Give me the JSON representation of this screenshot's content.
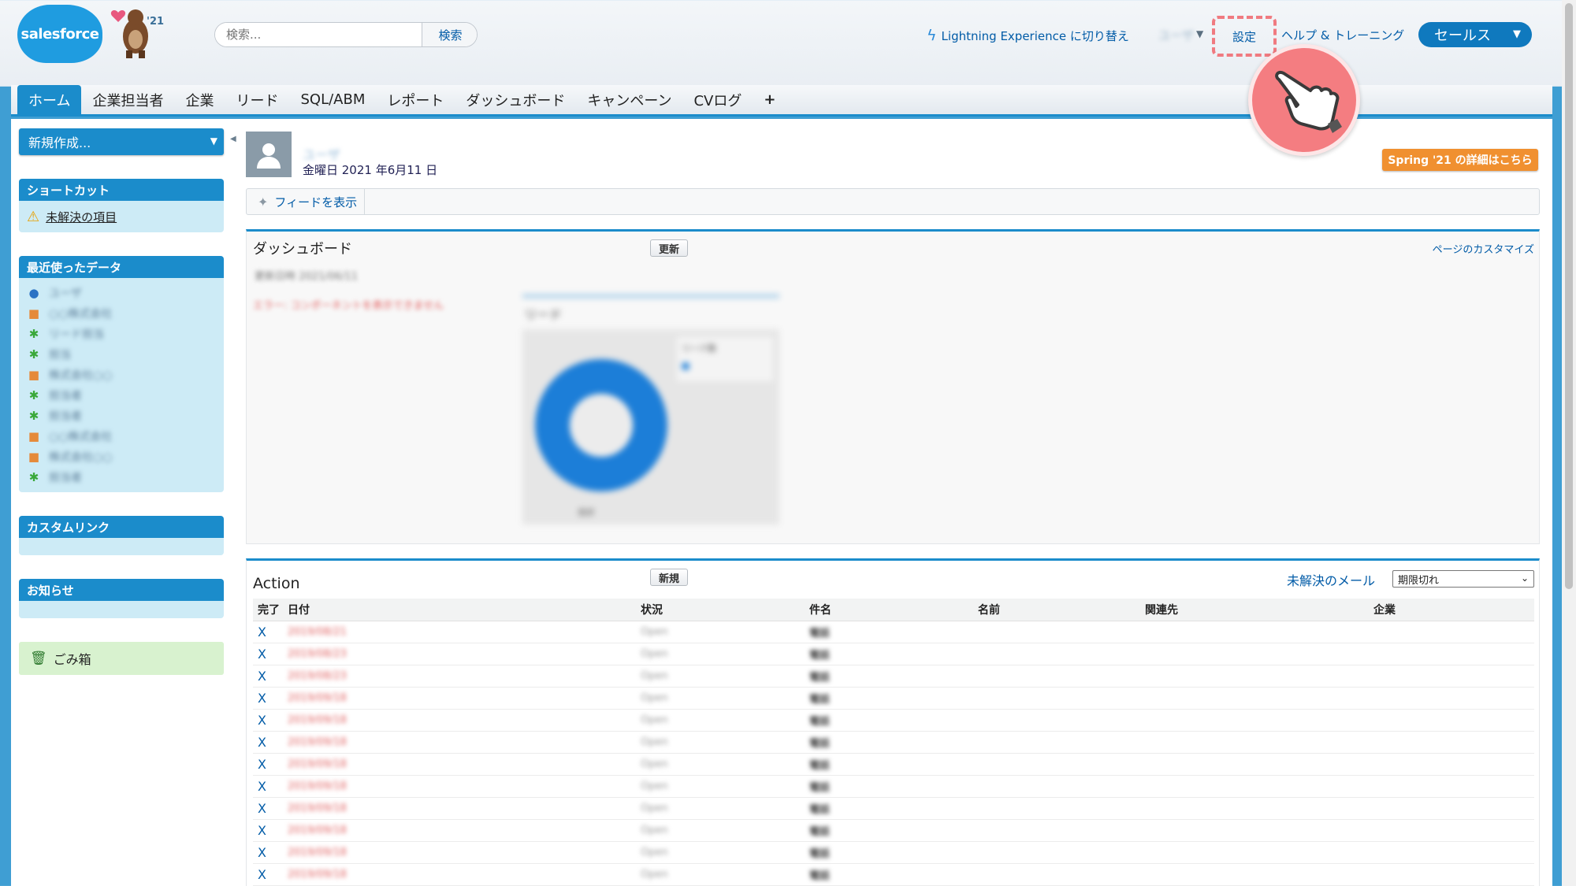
{
  "header": {
    "logo_text": "salesforce",
    "release_tag": "'21",
    "search_placeholder": "検索...",
    "search_button": "検索",
    "lightning_link": "Lightning Experience に切り替え",
    "user_name": "ユーザ",
    "settings_link": "設定",
    "help_link": "ヘルプ & トレーニング",
    "app_switcher": "セールス"
  },
  "tabs": [
    {
      "label": "ホーム",
      "active": true
    },
    {
      "label": "企業担当者"
    },
    {
      "label": "企業"
    },
    {
      "label": "リード"
    },
    {
      "label": "SQL/ABM"
    },
    {
      "label": "レポート"
    },
    {
      "label": "ダッシュボード"
    },
    {
      "label": "キャンペーン"
    },
    {
      "label": "CVログ"
    },
    {
      "label": "+"
    }
  ],
  "sidebar": {
    "new_create": "新規作成...",
    "shortcuts": {
      "title": "ショートカット",
      "items": [
        "未解決の項目"
      ]
    },
    "recent": {
      "title": "最近使ったデータ",
      "items": [
        {
          "icon": "person-icon",
          "label": "ユーザ"
        },
        {
          "icon": "building-icon",
          "label": "○○株式会社"
        },
        {
          "icon": "lead-icon",
          "label": "リード担当"
        },
        {
          "icon": "lead-icon",
          "label": "担当"
        },
        {
          "icon": "building-icon",
          "label": "株式会社○○"
        },
        {
          "icon": "lead-icon",
          "label": "担当者"
        },
        {
          "icon": "lead-icon",
          "label": "担当者"
        },
        {
          "icon": "building-icon",
          "label": "○○株式会社"
        },
        {
          "icon": "building-icon",
          "label": "株式会社○○"
        },
        {
          "icon": "lead-icon",
          "label": "担当者"
        }
      ]
    },
    "custom_links": {
      "title": "カスタムリンク"
    },
    "news": {
      "title": "お知らせ"
    },
    "trash": "ごみ箱"
  },
  "profile": {
    "name": "ユーザ",
    "date": "金曜日 2021 年6月11 日",
    "spring_badge": "Spring '21 の詳細はこちら",
    "feed_toggle": "フィードを表示"
  },
  "dashboard": {
    "title": "ダッシュボード",
    "refresh": "更新",
    "customize": "ページのカスタマイズ",
    "meta": "更新日時 2021/06/11",
    "error": "エラー: コンポーネントを表示できません",
    "chart_title": "リード",
    "legend": "リード数",
    "chart_footer": "合計"
  },
  "action": {
    "title": "Action",
    "new_button": "新規",
    "open_mail": "未解決のメール",
    "filter_selected": "期限切れ",
    "columns": [
      "完了",
      "日付",
      "状況",
      "件名",
      "名前",
      "関連先",
      "企業"
    ],
    "rows": [
      {
        "done": "X",
        "date": "2019/08/21",
        "status": "Open",
        "subject": "電話"
      },
      {
        "done": "X",
        "date": "2019/08/23",
        "status": "Open",
        "subject": "電話"
      },
      {
        "done": "X",
        "date": "2019/08/23",
        "status": "Open",
        "subject": "電話"
      },
      {
        "done": "X",
        "date": "2019/09/18",
        "status": "Open",
        "subject": "電話"
      },
      {
        "done": "X",
        "date": "2019/09/18",
        "status": "Open",
        "subject": "電話"
      },
      {
        "done": "X",
        "date": "2019/09/18",
        "status": "Open",
        "subject": "電話"
      },
      {
        "done": "X",
        "date": "2019/09/18",
        "status": "Open",
        "subject": "電話"
      },
      {
        "done": "X",
        "date": "2019/09/18",
        "status": "Open",
        "subject": "電話"
      },
      {
        "done": "X",
        "date": "2019/09/18",
        "status": "Open",
        "subject": "電話"
      },
      {
        "done": "X",
        "date": "2019/09/18",
        "status": "Open",
        "subject": "電話"
      },
      {
        "done": "X",
        "date": "2019/09/18",
        "status": "Open",
        "subject": "電話"
      },
      {
        "done": "X",
        "date": "2019/09/18",
        "status": "Open",
        "subject": "電話"
      }
    ]
  },
  "colors": {
    "brand_blue": "#1b8ccb",
    "accent_orange": "#f09030",
    "highlight_pink": "#f47d81"
  }
}
